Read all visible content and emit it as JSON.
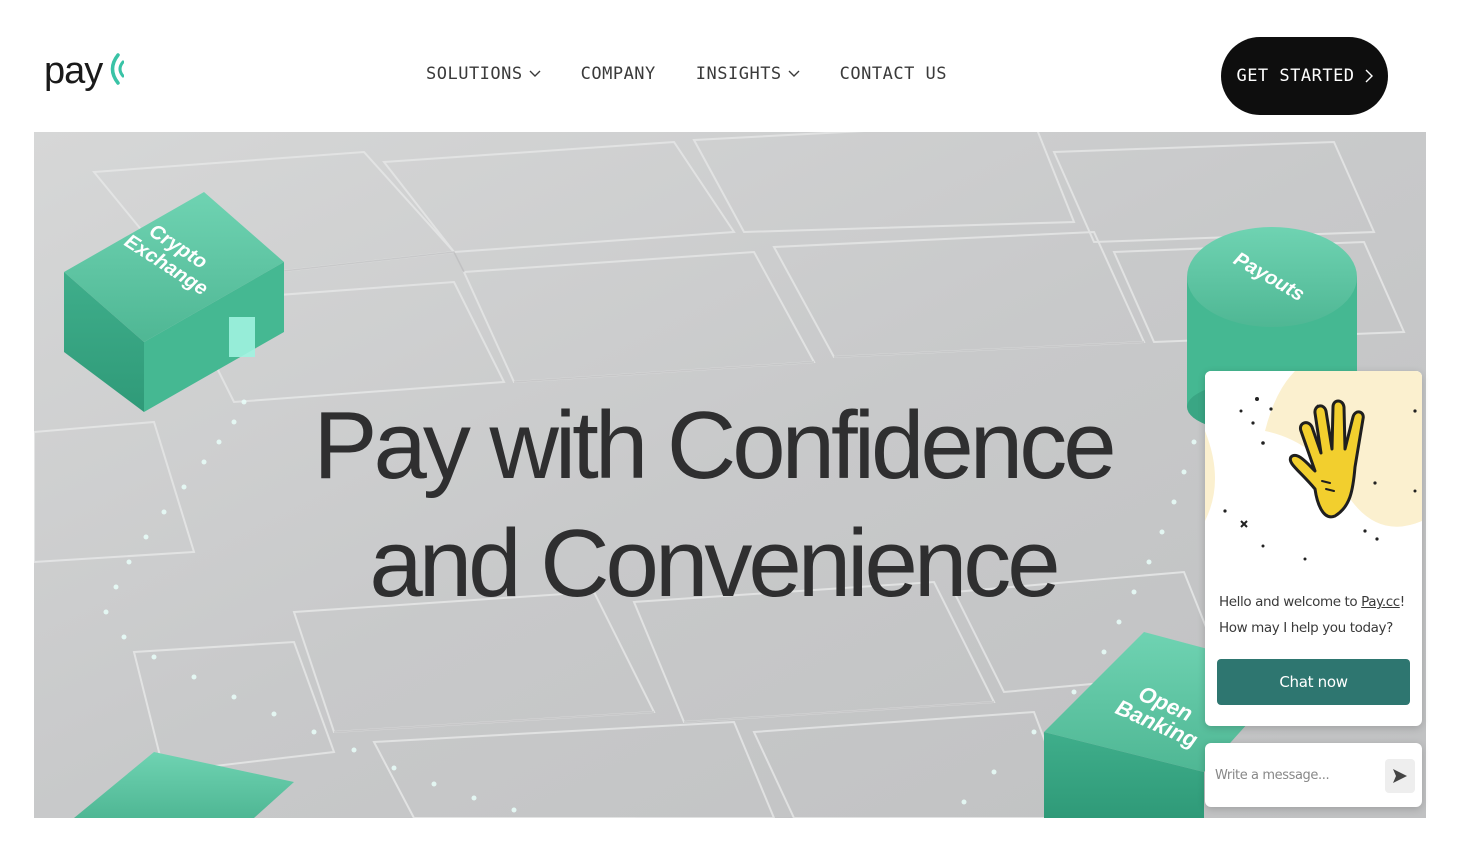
{
  "header": {
    "logo_text": "pay",
    "logo_icon": "signal-wave-icon",
    "nav": [
      {
        "label": "SOLUTIONS",
        "has_dropdown": true
      },
      {
        "label": "COMPANY",
        "has_dropdown": false
      },
      {
        "label": "INSIGHTS",
        "has_dropdown": true
      },
      {
        "label": "CONTACT US",
        "has_dropdown": false
      }
    ],
    "cta_label": "GET STARTED"
  },
  "hero": {
    "title_line1": "Pay with Confidence",
    "title_line2": "and Convenience",
    "blocks": {
      "crypto_line1": "Crypto",
      "crypto_line2": "Exchange",
      "payouts": "Payouts",
      "open_banking_line1": "Open",
      "open_banking_line2": "Banking"
    }
  },
  "chat": {
    "greeting_prefix": "Hello and welcome to ",
    "greeting_link": "Pay.cc",
    "greeting_suffix": "!",
    "greeting_line2": "How may I help you today?",
    "button_label": "Chat now",
    "input_placeholder": "Write a message...",
    "illustration_icon": "waving-hand-icon",
    "send_icon": "send-arrow-icon"
  },
  "colors": {
    "accent_teal": "#2e7670",
    "block_mint": "#5fc9a7",
    "cta_bg": "#0e0e0e",
    "hero_bg": "#c9cacb",
    "hand_yellow": "#f2cf2e"
  }
}
